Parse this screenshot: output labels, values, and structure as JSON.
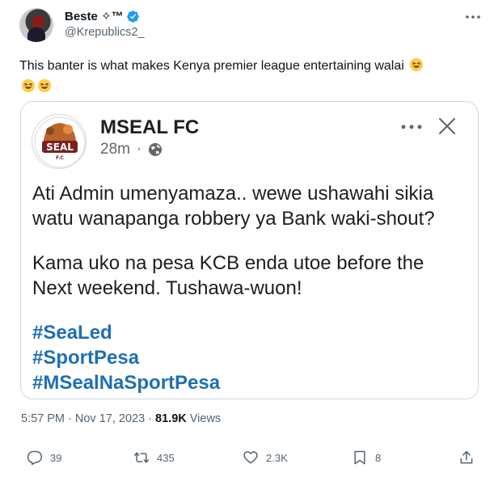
{
  "author": {
    "display_name": "Beste ✧™",
    "handle": "@Krepublics2_"
  },
  "tweet": {
    "text": "This banter is what makes Kenya premier league entertaining walai",
    "emoji": "laughing-face"
  },
  "embedded_post": {
    "page_name": "MSEAL FC",
    "age": "28m",
    "paragraph1": "Ati Admin umenyamaza.. wewe ushawahi sikia watu wanapanga robbery ya Bank waki-shout?",
    "paragraph2": "Kama uko na pesa KCB enda utoe before the Next weekend. Tushawa-wuon!",
    "hashtags": [
      "#SeaLed",
      "#SportPesa",
      "#MSealNaSportPesa"
    ],
    "logo_text": "SEAL",
    "logo_sub": "F.C"
  },
  "timestamp": {
    "time": "5:57 PM · Nov 17, 2023 · ",
    "views_count": "81.9K",
    "views_label": " Views"
  },
  "actions": {
    "replies": "39",
    "retweets": "435",
    "likes": "2.3K",
    "bookmarks": "8"
  },
  "colors": {
    "verified": "#1d9bf0",
    "hashtag": "#1f6fb3",
    "secondary_text": "#536471"
  }
}
